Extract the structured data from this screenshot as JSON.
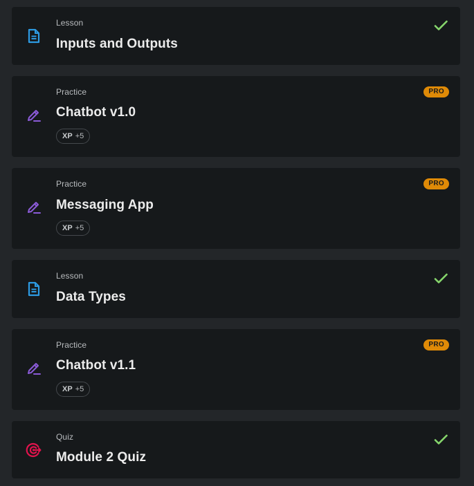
{
  "colors": {
    "page_bg": "#232629",
    "card_bg": "#16191b",
    "lesson_icon": "#2d9be3",
    "practice_icon": "#8b5bd8",
    "quiz_icon": "#e2134d",
    "check": "#86d66c",
    "pro_badge": "#df8a07"
  },
  "items": [
    {
      "type": "Lesson",
      "title": "Inputs and Outputs",
      "icon": "lesson-document-icon",
      "completed": true
    },
    {
      "type": "Practice",
      "title": "Chatbot v1.0",
      "icon": "practice-pencil-icon",
      "badge": "PRO",
      "xp_label": "XP",
      "xp_value": "+5"
    },
    {
      "type": "Practice",
      "title": "Messaging App",
      "icon": "practice-pencil-icon",
      "badge": "PRO",
      "xp_label": "XP",
      "xp_value": "+5"
    },
    {
      "type": "Lesson",
      "title": "Data Types",
      "icon": "lesson-document-icon",
      "completed": true
    },
    {
      "type": "Practice",
      "title": "Chatbot v1.1",
      "icon": "practice-pencil-icon",
      "badge": "PRO",
      "xp_label": "XP",
      "xp_value": "+5"
    },
    {
      "type": "Quiz",
      "title": "Module 2 Quiz",
      "icon": "quiz-target-icon",
      "completed": true
    }
  ]
}
